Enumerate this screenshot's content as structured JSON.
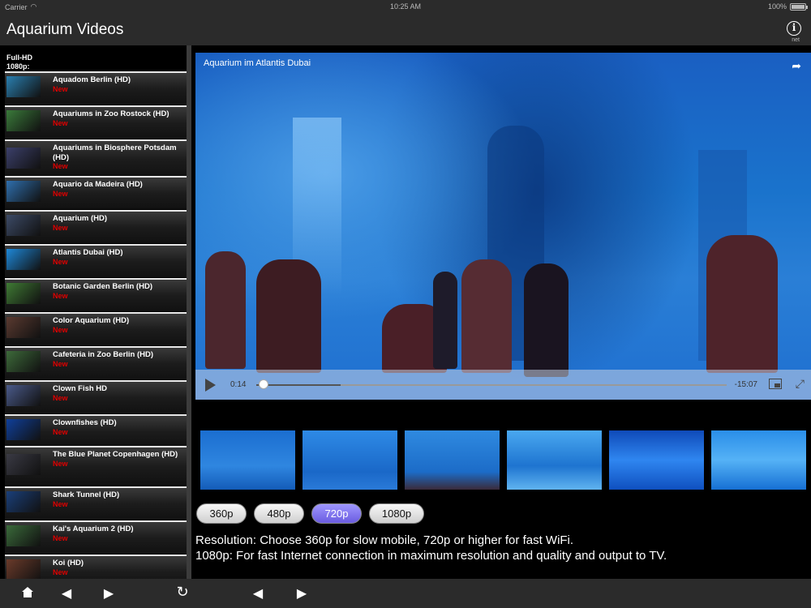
{
  "status_bar": {
    "carrier": "Carrier",
    "time": "10:25 AM",
    "battery": "100%"
  },
  "nav": {
    "title": "Aquarium Videos",
    "info_caption": "net"
  },
  "sidebar": {
    "section": "Full-HD\n1080p:",
    "items": [
      {
        "label": "Aquadom Berlin (HD)",
        "badge": "New"
      },
      {
        "label": "Aquariums in Zoo Rostock (HD)",
        "badge": "New"
      },
      {
        "label": "Aquariums in Biosphere Potsdam (HD)",
        "badge": "New"
      },
      {
        "label": "Aquario da Madeira (HD)",
        "badge": "New"
      },
      {
        "label": "Aquarium (HD)",
        "badge": "New"
      },
      {
        "label": "Atlantis Dubai (HD)",
        "badge": "New"
      },
      {
        "label": "Botanic Garden Berlin (HD)",
        "badge": "New"
      },
      {
        "label": "Color Aquarium (HD)",
        "badge": "New"
      },
      {
        "label": "Cafeteria in Zoo Berlin (HD)",
        "badge": "New"
      },
      {
        "label": "Clown Fish HD",
        "badge": "New"
      },
      {
        "label": "Clownfishes (HD)",
        "badge": "New"
      },
      {
        "label": "The Blue Planet Copenhagen (HD)",
        "badge": "New"
      },
      {
        "label": "Shark Tunnel (HD)",
        "badge": "New"
      },
      {
        "label": "Kai's Aquarium 2 (HD)",
        "badge": "New"
      },
      {
        "label": "Koi (HD)",
        "badge": "New"
      }
    ]
  },
  "player": {
    "title": "Aquarium im Atlantis Dubai",
    "elapsed": "0:14",
    "remaining": "-15:07",
    "progress": 0.015,
    "buffered": 0.18
  },
  "resolutions": {
    "options": [
      "360p",
      "480p",
      "720p",
      "1080p"
    ],
    "selected": "720p"
  },
  "notes": [
    "Resolution: Choose 360p for slow mobile, 720p or higher for fast WiFi.",
    "1080p: For fast Internet connection in maximum resolution and quality and output to TV."
  ],
  "colors": {
    "accent": "#6a5ce0",
    "badge": "#e00000",
    "bar": "#2b2b2b"
  },
  "icons": {
    "info": "info-icon",
    "share": "share-icon",
    "play": "play-icon",
    "home": "home-icon",
    "back": "back-arrow-icon",
    "forward": "forward-arrow-icon",
    "reload": "reload-icon"
  }
}
